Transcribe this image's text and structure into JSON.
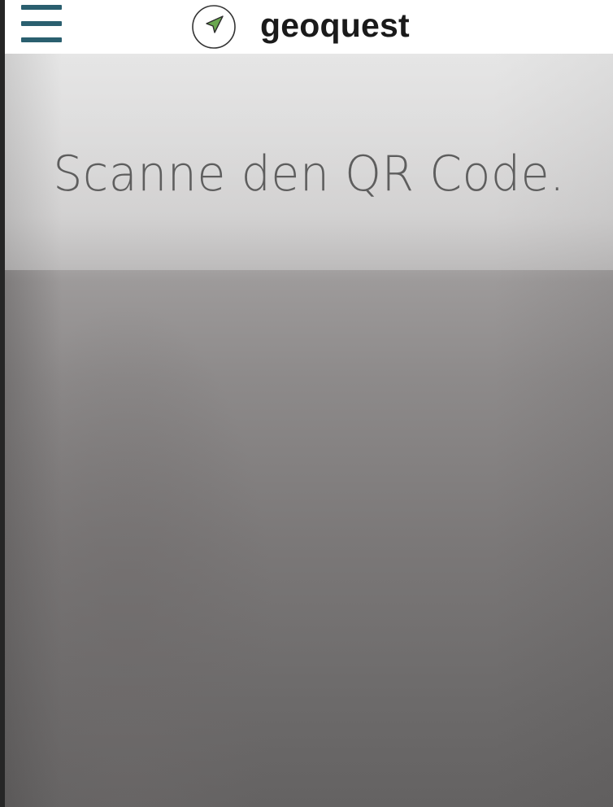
{
  "header": {
    "menu_icon": "hamburger-menu-icon",
    "logo_icon": "compass-arrow-icon",
    "app_name": "geoquest",
    "menu_color": "#2a5f6f",
    "logo_arrow_color": "#6aa84f"
  },
  "scanner": {
    "instruction": "Scanne den QR Code."
  }
}
